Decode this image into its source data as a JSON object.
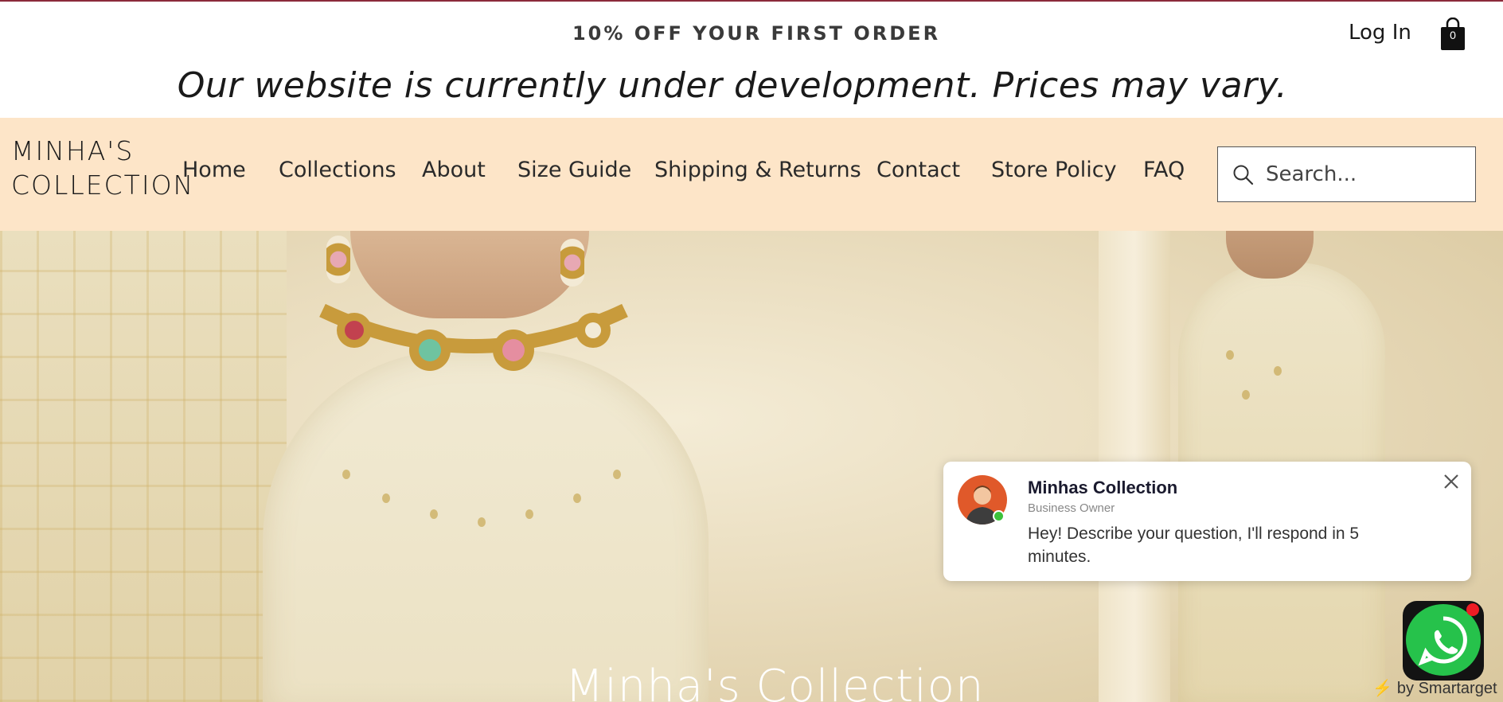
{
  "promo": {
    "offer_text": "10% OFF YOUR FIRST ORDER",
    "notice": "Our website is currently under development. Prices may vary.",
    "login_label": "Log In",
    "cart_count": "0"
  },
  "header": {
    "brand_line1": "MINHA'S",
    "brand_line2": "COLLECTION",
    "nav": [
      {
        "label": "Home"
      },
      {
        "label": "Collections"
      },
      {
        "label": "About"
      },
      {
        "label": "Size Guide"
      },
      {
        "label": "Shipping & Returns"
      },
      {
        "label": "Contact"
      },
      {
        "label": "Store Policy"
      },
      {
        "label": "FAQ"
      }
    ],
    "search_placeholder": "Search..."
  },
  "hero": {
    "title": "Minha's Collection"
  },
  "chat": {
    "name": "Minhas Collection",
    "role": "Business Owner",
    "message": "Hey! Describe your question, I'll respond in 5 minutes."
  },
  "widget": {
    "powered_by": "by Smartarget"
  },
  "colors": {
    "nav_background": "#fde5c8",
    "accent_line": "#8b2a3a",
    "whatsapp_green": "#26c24b"
  },
  "icons": [
    "cart-icon",
    "search-icon",
    "close-icon",
    "whatsapp-icon",
    "bolt-icon"
  ]
}
